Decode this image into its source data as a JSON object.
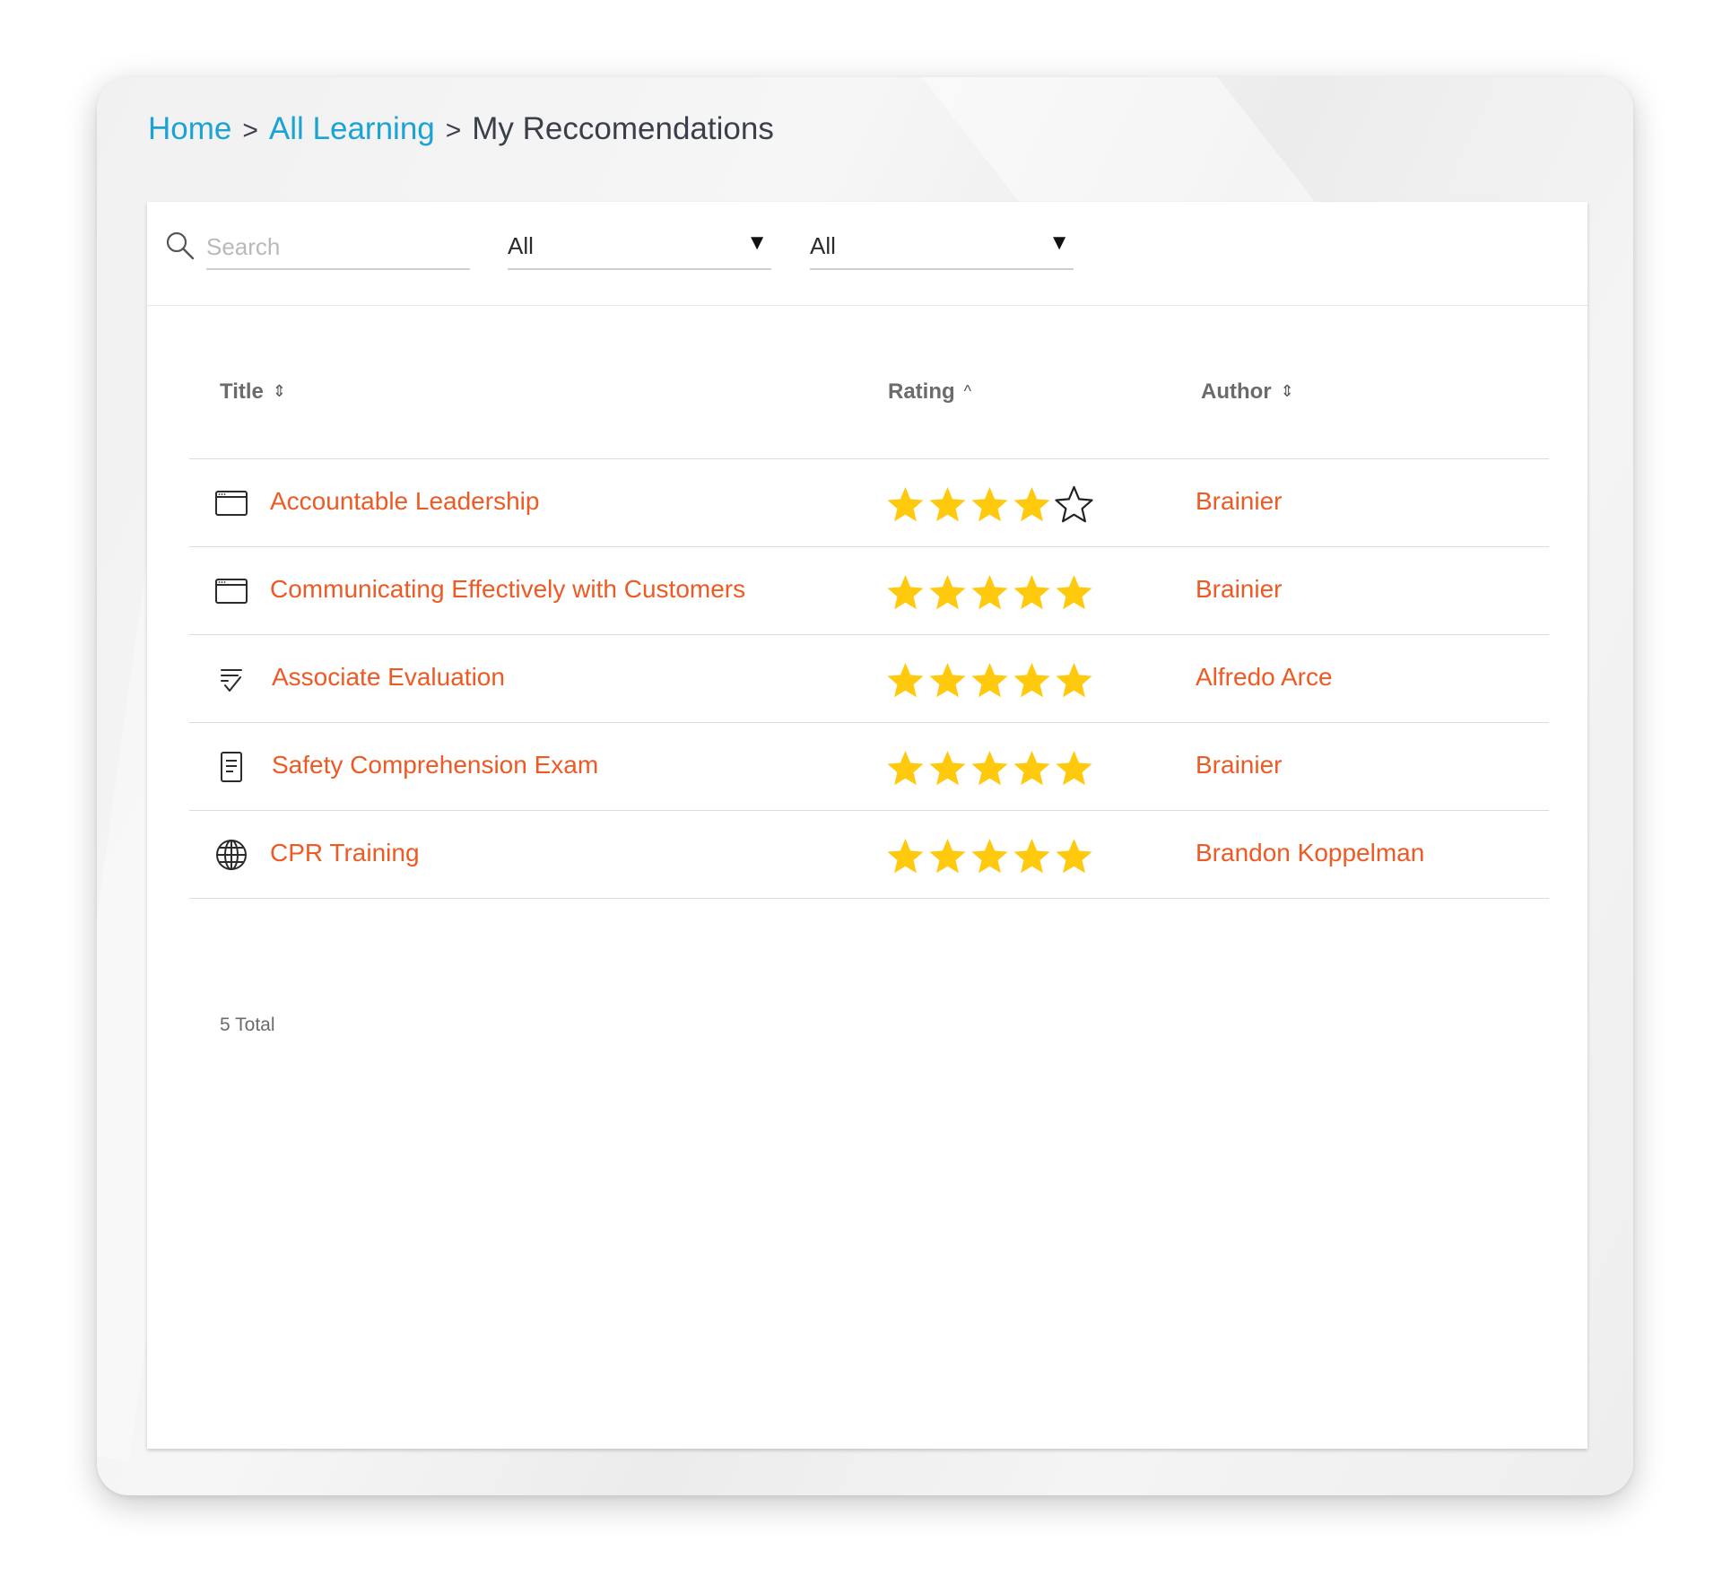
{
  "breadcrumb": {
    "home": "Home",
    "separator": ">",
    "all_learning": "All Learning",
    "current": "My Reccomendations"
  },
  "filters": {
    "search_placeholder": "Search",
    "search_value": "",
    "select1_value": "All",
    "select2_value": "All"
  },
  "table": {
    "columns": {
      "title": "Title",
      "rating": "Rating",
      "author": "Author"
    },
    "rows": [
      {
        "icon": "course-window-icon",
        "title": "Accountable Leadership",
        "rating": 4,
        "max_rating": 5,
        "author": "Brainier"
      },
      {
        "icon": "course-window-icon",
        "title": "Communicating Effectively with Customers",
        "rating": 5,
        "max_rating": 5,
        "author": "Brainier"
      },
      {
        "icon": "evaluation-checklist-icon",
        "title": "Associate Evaluation",
        "rating": 5,
        "max_rating": 5,
        "author": "Alfredo Arce"
      },
      {
        "icon": "exam-document-icon",
        "title": "Safety Comprehension Exam",
        "rating": 5,
        "max_rating": 5,
        "author": "Brainier"
      },
      {
        "icon": "globe-icon",
        "title": "CPR Training",
        "rating": 5,
        "max_rating": 5,
        "author": "Brandon Koppelman"
      }
    ],
    "total": "5 Total"
  },
  "colors": {
    "link_blue": "#1aa3d4",
    "accent_orange": "#ee5a24",
    "star_gold": "#ffc90e"
  }
}
